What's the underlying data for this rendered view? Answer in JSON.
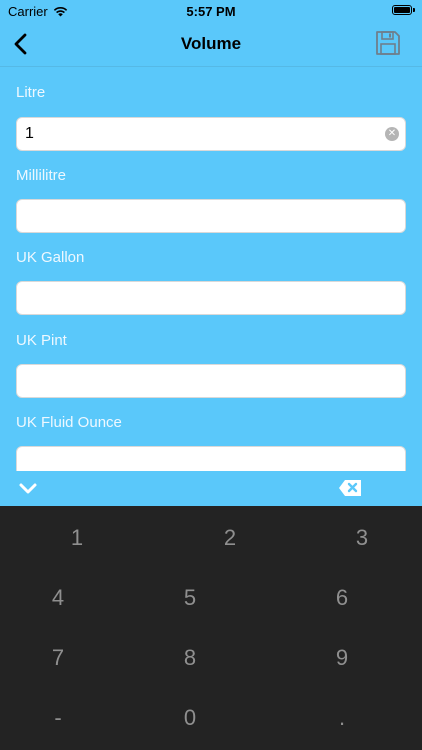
{
  "status_bar": {
    "carrier": "Carrier",
    "time": "5:57 PM"
  },
  "nav": {
    "title": "Volume",
    "back_icon": "chevron-left-icon",
    "save_icon": "floppy-disk-icon"
  },
  "fields": [
    {
      "label": "Litre",
      "value": "1",
      "placeholder": ""
    },
    {
      "label": "Millilitre",
      "value": "",
      "placeholder": ""
    },
    {
      "label": "UK Gallon",
      "value": "",
      "placeholder": ""
    },
    {
      "label": "UK Pint",
      "value": "",
      "placeholder": ""
    },
    {
      "label": "UK Fluid Ounce",
      "value": "",
      "placeholder": ""
    }
  ],
  "accessory": {
    "dismiss_icon": "chevron-down-icon",
    "delete_icon": "backspace-icon"
  },
  "keypad": {
    "keys": [
      "1",
      "2",
      "3",
      "4",
      "5",
      "6",
      "7",
      "8",
      "9",
      "-",
      "0",
      "."
    ]
  },
  "colors": {
    "background": "#5ac8fa",
    "keypad": "#232323",
    "key_text": "#8f8f8f"
  }
}
